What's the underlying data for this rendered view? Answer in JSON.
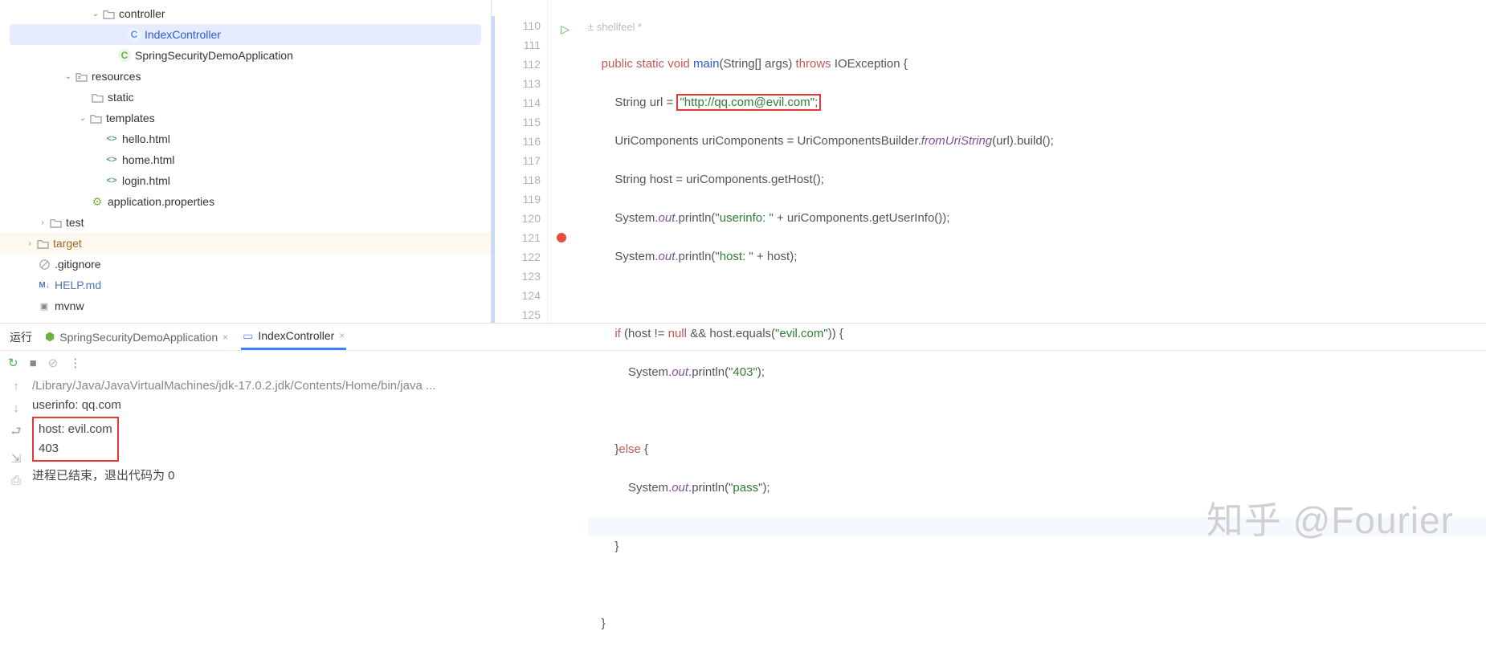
{
  "tree": {
    "controller": "controller",
    "indexController": "IndexController",
    "springApp": "SpringSecurityDemoApplication",
    "resources": "resources",
    "static": "static",
    "templates": "templates",
    "hello": "hello.html",
    "home": "home.html",
    "login": "login.html",
    "appProps": "application.properties",
    "test": "test",
    "target": "target",
    "gitignore": ".gitignore",
    "help": "HELP.md",
    "mdIcon": "M↓",
    "mvnw": "mvnw"
  },
  "editor": {
    "author": "± shellfeel *",
    "lines": [
      "110",
      "111",
      "112",
      "113",
      "114",
      "115",
      "116",
      "117",
      "118",
      "119",
      "120",
      "121",
      "122",
      "123",
      "124",
      "125"
    ],
    "code": {
      "l110": {
        "pre": "    ",
        "k1": "public",
        "sp1": " ",
        "k2": "static",
        "sp2": " ",
        "k3": "void",
        "sp3": " ",
        "m": "main",
        "args": "(String[] args) ",
        "k4": "throws",
        "sp4": " ",
        "ex": "IOException",
        " br": " {"
      },
      "l111": {
        "pre": "        ",
        "t": "String url = ",
        "str": "\"http://qq.com@evil.com\"",
        "semi": ";"
      },
      "l112": {
        "pre": "        ",
        "a": "UriComponents uriComponents = UriComponentsBuilder.",
        "m": "fromUriString",
        "b": "(url).build();"
      },
      "l113": {
        "pre": "        ",
        "t": "String host = uriComponents.getHost();"
      },
      "l114": {
        "pre": "        ",
        "a": "System.",
        "f": "out",
        "b": ".println(",
        "s": "\"userinfo: \"",
        "c": " + uriComponents.getUserInfo());"
      },
      "l115": {
        "pre": "        ",
        "a": "System.",
        "f": "out",
        "b": ".println(",
        "s": "\"host: \"",
        "c": " + host);"
      },
      "l117": {
        "pre": "        ",
        "k": "if",
        "a": " (host != ",
        "n": "null",
        "b": " && host.equals(",
        "s": "\"evil.com\"",
        "c": ")) {"
      },
      "l118": {
        "pre": "            ",
        "a": "System.",
        "f": "out",
        "b": ".println(",
        "s": "\"403\"",
        "c": ");"
      },
      "l120": {
        "pre": "        }",
        "k": "else",
        "a": " {"
      },
      "l121": {
        "pre": "            ",
        "a": "System.",
        "f": "out",
        "b": ".println(",
        "s": "\"pass\"",
        "c": ");"
      },
      "l123": {
        "pre": "        }"
      },
      "l125": {
        "pre": "    }"
      }
    }
  },
  "runTabs": {
    "label": "运行",
    "tab1": "SpringSecurityDemoApplication",
    "tab2": "IndexController"
  },
  "console": {
    "cmd": "/Library/Java/JavaVirtualMachines/jdk-17.0.2.jdk/Contents/Home/bin/java ...",
    "l1": "userinfo: qq.com",
    "l2": "host: evil.com",
    "l3": "403",
    "exit": "进程已结束，退出代码为 0"
  },
  "watermark": "知乎 @Fourier"
}
